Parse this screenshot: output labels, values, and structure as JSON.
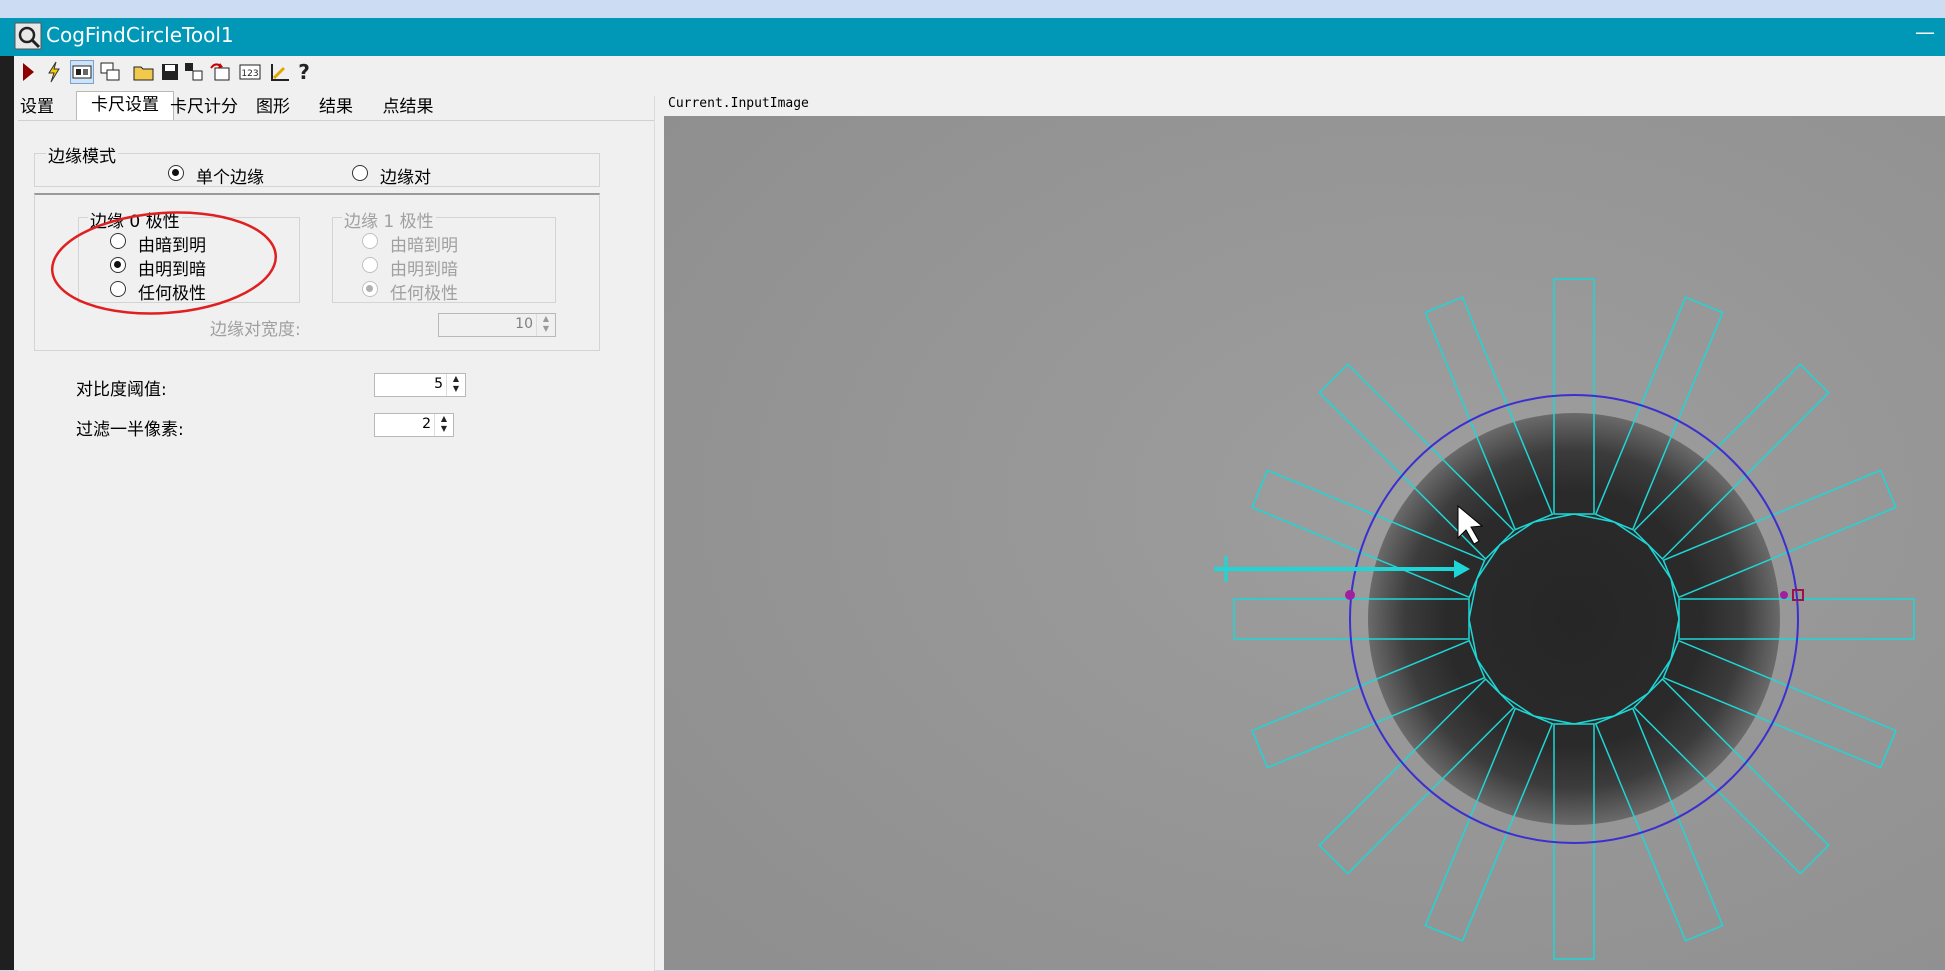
{
  "window": {
    "title": "CogFindCircleTool1",
    "minimize_glyph": "—"
  },
  "toolbar": {
    "icons": [
      "run-icon",
      "electric-icon",
      "display-icon",
      "window-icon",
      "open-folder-icon",
      "save-icon",
      "copy-icon",
      "reset-icon",
      "numeric-icon",
      "measure-icon",
      "help-icon"
    ]
  },
  "tabs": [
    "设置",
    "卡尺设置",
    "卡尺计分",
    "图形",
    "结果",
    "点结果"
  ],
  "active_tab": "卡尺设置",
  "edge_mode": {
    "label": "边缘模式",
    "options": [
      "单个边缘",
      "边缘对"
    ],
    "selected": "单个边缘"
  },
  "edge0": {
    "label": "边缘 0 极性",
    "options": [
      "由暗到明",
      "由明到暗",
      "任何极性"
    ],
    "selected": "由明到暗"
  },
  "edge1": {
    "label": "边缘 1 极性",
    "options": [
      "由暗到明",
      "由明到暗",
      "任何极性"
    ],
    "selected": "任何极性"
  },
  "edge_pair_width": {
    "label": "边缘对宽度:",
    "value": "10"
  },
  "contrast_threshold": {
    "label": "对比度阈值:",
    "value": "5"
  },
  "filter_half_pixels": {
    "label": "过滤一半像素:",
    "value": "2"
  },
  "display": {
    "caption": "Current.InputImage"
  },
  "colors": {
    "titlebar": "#0098b6",
    "caliper": "#1fd6d6",
    "circle": "#3b2fd0",
    "annotation": "#e02020"
  }
}
